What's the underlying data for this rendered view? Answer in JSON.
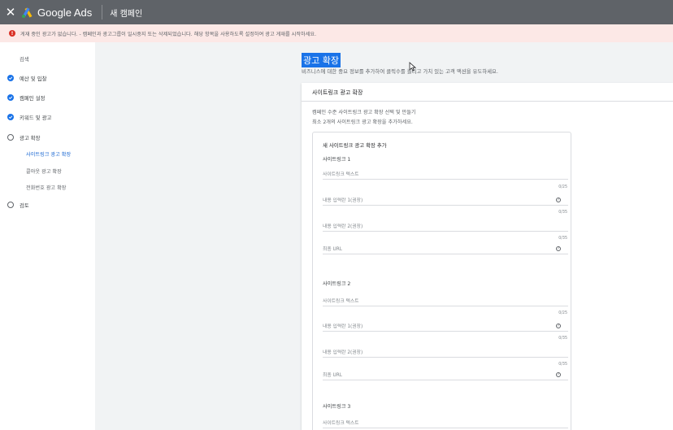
{
  "topbar": {
    "close_icon": "close-icon",
    "brand": "Google Ads",
    "campaign_title": "새 캠페인"
  },
  "alert": {
    "icon": "error-icon",
    "text": "게재 중인 광고가 없습니다. - 캠페인과 광고그룹이 일시중지 또는 삭제되었습니다. 해당 항목을 사용하도록 설정하여 광고 게재를 시작하세요."
  },
  "sidebar": {
    "search_label": "검색",
    "items": [
      {
        "label": "예산 및 입찰",
        "state": "done"
      },
      {
        "label": "캠페인 설정",
        "state": "done"
      },
      {
        "label": "키워드 및 광고",
        "state": "done"
      },
      {
        "label": "광고 확장",
        "state": "current"
      },
      {
        "label": "검토",
        "state": "todo"
      }
    ],
    "sub_items": [
      {
        "label": "사이트링크 광고 확장",
        "active": true
      },
      {
        "label": "콜아웃 광고 확장",
        "active": false
      },
      {
        "label": "전화번호 광고 확장",
        "active": false
      }
    ]
  },
  "main": {
    "title": "광고 확장",
    "description": "비즈니스에 대한 중요 정보를 추가하여 클릭수를 늘리고 가치 있는 고객 액션을 유도하세요."
  },
  "card": {
    "title": "사이트링크 광고 확장",
    "desc1": "캠페인 수준 사이트링크 광고 확장 선택 및 만들기",
    "desc2": "최소 2개의 사이트링크 광고 확장을 추가하세요.",
    "inner_title": "새 사이트링크 광고 확장 추가",
    "sitelinks": [
      {
        "title": "사이트링크 1",
        "text_placeholder": "사이트링크 텍스트",
        "text_counter": "0/25",
        "line1_placeholder": "내용 입력란 1(권장)",
        "line1_counter": "0/35",
        "line2_placeholder": "내용 입력란 2(권장)",
        "line2_counter": "0/35",
        "url_label": "최종 URL"
      },
      {
        "title": "사이트링크 2",
        "text_placeholder": "사이트링크 텍스트",
        "text_counter": "0/25",
        "line1_placeholder": "내용 입력란 1(권장)",
        "line1_counter": "0/35",
        "line2_placeholder": "내용 입력란 2(권장)",
        "line2_counter": "0/35",
        "url_label": "최종 URL"
      },
      {
        "title": "사이트링크 3",
        "text_placeholder": "사이트링크 텍스트"
      }
    ],
    "help_glyph": "?"
  },
  "colors": {
    "topbar": "#5f6368",
    "alert_bg": "#fce8e6",
    "alert_icon": "#d93025",
    "accent": "#1a73e8",
    "active_nav": "#1967d2",
    "background": "#f1f3f4"
  }
}
